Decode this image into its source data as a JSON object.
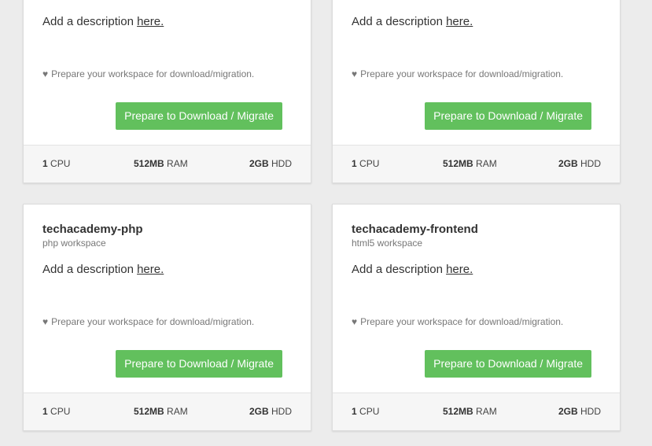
{
  "colors": {
    "background": "#ececec",
    "card": "#ffffff",
    "footer": "#f6f6f6",
    "button": "#62c05d"
  },
  "cards": [
    {
      "name": "",
      "subtitle": "",
      "description_prefix": "Add a description ",
      "description_link": "here.",
      "note": "Prepare your workspace for download/migration.",
      "button_label": "Prepare to Download / Migrate",
      "specs": {
        "cpu_value": "1",
        "cpu_unit": " CPU",
        "ram_value": "512MB",
        "ram_unit": " RAM",
        "hdd_value": "2GB",
        "hdd_unit": " HDD"
      }
    },
    {
      "name": "",
      "subtitle": "",
      "description_prefix": "Add a description ",
      "description_link": "here.",
      "note": "Prepare your workspace for download/migration.",
      "button_label": "Prepare to Download / Migrate",
      "specs": {
        "cpu_value": "1",
        "cpu_unit": " CPU",
        "ram_value": "512MB",
        "ram_unit": " RAM",
        "hdd_value": "2GB",
        "hdd_unit": " HDD"
      }
    },
    {
      "name": "techacademy-php",
      "subtitle": "php workspace",
      "description_prefix": "Add a description ",
      "description_link": "here.",
      "note": "Prepare your workspace for download/migration.",
      "button_label": "Prepare to Download / Migrate",
      "specs": {
        "cpu_value": "1",
        "cpu_unit": " CPU",
        "ram_value": "512MB",
        "ram_unit": " RAM",
        "hdd_value": "2GB",
        "hdd_unit": " HDD"
      }
    },
    {
      "name": "techacademy-frontend",
      "subtitle": "html5 workspace",
      "description_prefix": "Add a description ",
      "description_link": "here.",
      "note": "Prepare your workspace for download/migration.",
      "button_label": "Prepare to Download / Migrate",
      "specs": {
        "cpu_value": "1",
        "cpu_unit": " CPU",
        "ram_value": "512MB",
        "ram_unit": " RAM",
        "hdd_value": "2GB",
        "hdd_unit": " HDD"
      }
    }
  ]
}
